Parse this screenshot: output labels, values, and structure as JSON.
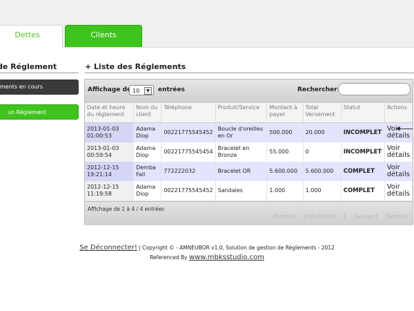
{
  "tabs": {
    "dettes": "Dettes",
    "clients": "Clients"
  },
  "sidebar": {
    "title": "de Réglement",
    "btn_encours": "ments en cours",
    "btn_add": "un Réglement"
  },
  "main": {
    "title": "+ Liste des Réglements",
    "affichage_label": "Affichage de",
    "length_value": "10",
    "entrees_label": "entrées",
    "search_label": "Rechercher:",
    "search_value": ""
  },
  "table": {
    "headers": [
      "Date et heure du réglement",
      "Nom du client",
      "Téléphone",
      "Produit/Service",
      "Montant à payer",
      "Total Versement",
      "Statut",
      "Actions"
    ],
    "rows": [
      {
        "date": "2013-01-03 01:00:53",
        "nom": "Adama Diop",
        "tel": "00221775545452",
        "produit": "Boucle d'oreilles en Or",
        "montant": "500.000",
        "total": "20.000",
        "statut": "INCOMPLET",
        "action": "Voir détails"
      },
      {
        "date": "2013-01-03 00:59:54",
        "nom": "Adama Diop",
        "tel": "00221775545454",
        "produit": "Bracelet en Bronze",
        "montant": "55.000",
        "total": "0",
        "statut": "INCOMPLET",
        "action": "Voir détails"
      },
      {
        "date": "2012-12-15 19:21:14",
        "nom": "Demba Fall",
        "tel": "772222032",
        "produit": "Bracelet OR",
        "montant": "5.600.000",
        "total": "5.600.000",
        "statut": "COMPLET",
        "action": "Voir détails"
      },
      {
        "date": "2012-12-15 11:19:58",
        "nom": "Adama Diop",
        "tel": "00221775545452",
        "produit": "Sandales",
        "montant": "1.000",
        "total": "1.000",
        "statut": "COMPLET",
        "action": "Voir détails"
      }
    ]
  },
  "footer_table": {
    "info": "Affichage de 1 à 4 / 4 entrées",
    "pager": {
      "first": "Premier",
      "prev": "Précédent",
      "page": "1",
      "next": "Suivant",
      "last": "Dernier"
    }
  },
  "footer": {
    "logout": "Se Déconnecter!",
    "copyright": "| Copyright © - AMNEUBOR v1.0, Solution de gestion de Réglements - 2012",
    "referenced": "Referenced By",
    "site": "www.mbksstudio.com"
  },
  "colors": {
    "accent_green": "#3fc41d",
    "status_incomplet": "#d80000",
    "status_complet": "#169a16"
  }
}
